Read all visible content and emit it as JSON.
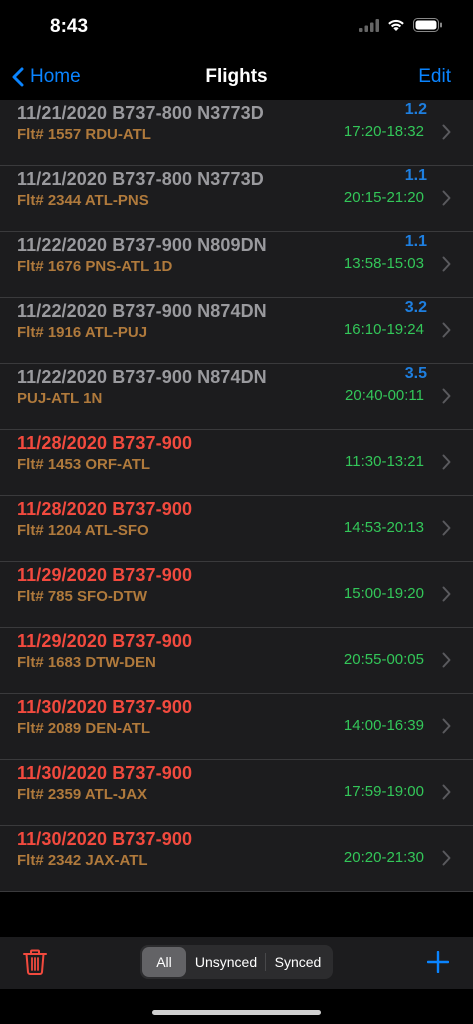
{
  "status": {
    "time": "8:43"
  },
  "nav": {
    "back_label": "Home",
    "title": "Flights",
    "edit_label": "Edit"
  },
  "flights": [
    {
      "title": "11/21/2020 B737-800 N3773D",
      "subtitle": "Flt# 1557 RDU-ATL",
      "hours": "1.2",
      "times": "17:20-18:32",
      "synced": true
    },
    {
      "title": "11/21/2020 B737-800 N3773D",
      "subtitle": "Flt# 2344 ATL-PNS",
      "hours": "1.1",
      "times": "20:15-21:20",
      "synced": true
    },
    {
      "title": "11/22/2020 B737-900 N809DN",
      "subtitle": "Flt# 1676 PNS-ATL 1D",
      "hours": "1.1",
      "times": "13:58-15:03",
      "synced": true
    },
    {
      "title": "11/22/2020 B737-900 N874DN",
      "subtitle": "Flt# 1916 ATL-PUJ",
      "hours": "3.2",
      "times": "16:10-19:24",
      "synced": true
    },
    {
      "title": "11/22/2020 B737-900 N874DN",
      "subtitle": "PUJ-ATL 1N",
      "hours": "3.5",
      "times": "20:40-00:11",
      "synced": true
    },
    {
      "title": "11/28/2020 B737-900",
      "subtitle": "Flt# 1453 ORF-ATL",
      "hours": "",
      "times": "11:30-13:21",
      "synced": false
    },
    {
      "title": "11/28/2020 B737-900",
      "subtitle": "Flt# 1204 ATL-SFO",
      "hours": "",
      "times": "14:53-20:13",
      "synced": false
    },
    {
      "title": "11/29/2020 B737-900",
      "subtitle": "Flt# 785 SFO-DTW",
      "hours": "",
      "times": "15:00-19:20",
      "synced": false
    },
    {
      "title": "11/29/2020 B737-900",
      "subtitle": "Flt# 1683 DTW-DEN",
      "hours": "",
      "times": "20:55-00:05",
      "synced": false
    },
    {
      "title": "11/30/2020 B737-900",
      "subtitle": "Flt# 2089 DEN-ATL",
      "hours": "",
      "times": "14:00-16:39",
      "synced": false
    },
    {
      "title": "11/30/2020 B737-900",
      "subtitle": "Flt# 2359 ATL-JAX",
      "hours": "",
      "times": "17:59-19:00",
      "synced": false
    },
    {
      "title": "11/30/2020 B737-900",
      "subtitle": "Flt# 2342 JAX-ATL",
      "hours": "",
      "times": "20:20-21:30",
      "synced": false
    }
  ],
  "toolbar": {
    "segments": [
      "All",
      "Unsynced",
      "Synced"
    ],
    "selected_segment": "All",
    "trash_icon": "trash-icon",
    "add_icon": "plus-icon"
  },
  "colors": {
    "accent": "#0a84ff",
    "synced_title": "#9a9a9e",
    "unsynced_title": "#f24a3e",
    "route": "#b07a3c",
    "times": "#33c759",
    "hours": "#1e7fe0"
  }
}
